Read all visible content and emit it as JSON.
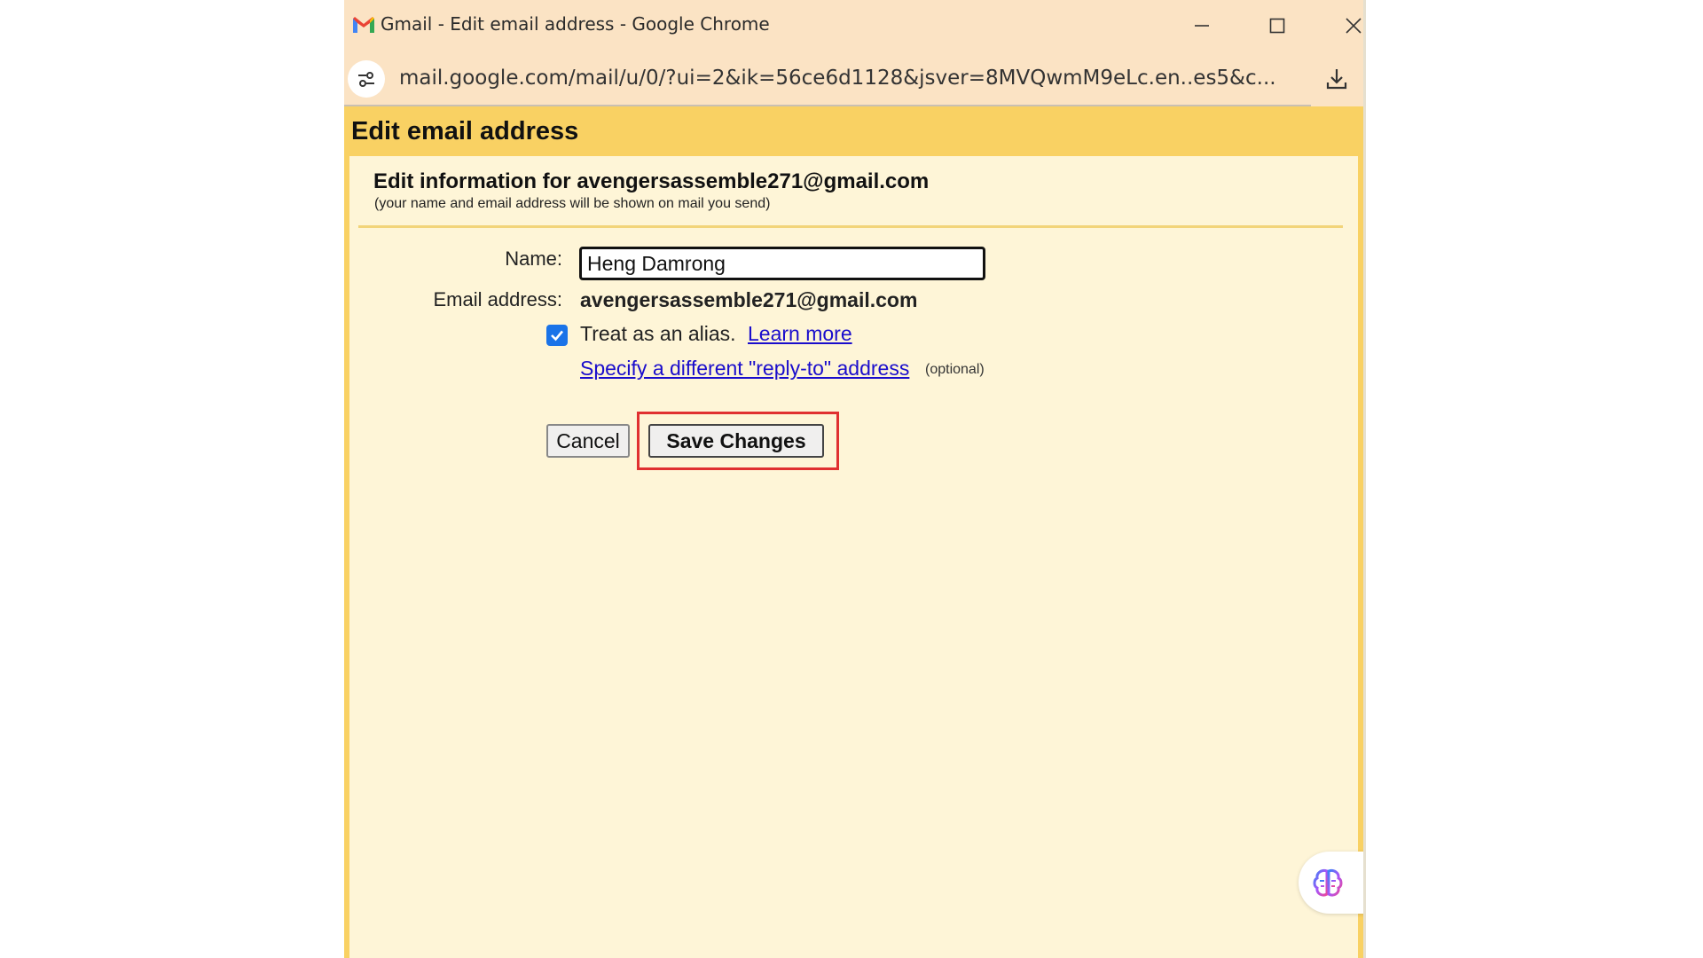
{
  "window": {
    "title": "Gmail - Edit email address - Google Chrome",
    "url": "mail.google.com/mail/u/0/?ui=2&ik=56ce6d1128&jsver=8MVQwmM9eLc.en..es5&c..."
  },
  "page": {
    "header": "Edit email address",
    "info_heading": "Edit information for avengersassemble271@gmail.com",
    "info_sub": "(your name and email address will be shown on mail you send)",
    "form": {
      "name_label": "Name:",
      "name_value": "Heng Damrong",
      "email_label": "Email address:",
      "email_value": "avengersassemble271@gmail.com",
      "alias_checked": true,
      "alias_text": "Treat as an alias.",
      "learn_more": "Learn more",
      "reply_to_link": "Specify a different \"reply-to\" address",
      "optional": "(optional)"
    },
    "buttons": {
      "cancel": "Cancel",
      "save": "Save Changes"
    }
  },
  "colors": {
    "header_bg": "#f9d163",
    "page_bg": "#fef5d7",
    "titlebar_bg": "#fbe3c4",
    "link": "#1a0dcc",
    "checkbox": "#1a73e8",
    "highlight": "#e03030"
  },
  "icons": {
    "gmail": "gmail-logo-icon",
    "site_info": "tune-icon",
    "download": "download-icon",
    "assistant": "brain-icon"
  }
}
